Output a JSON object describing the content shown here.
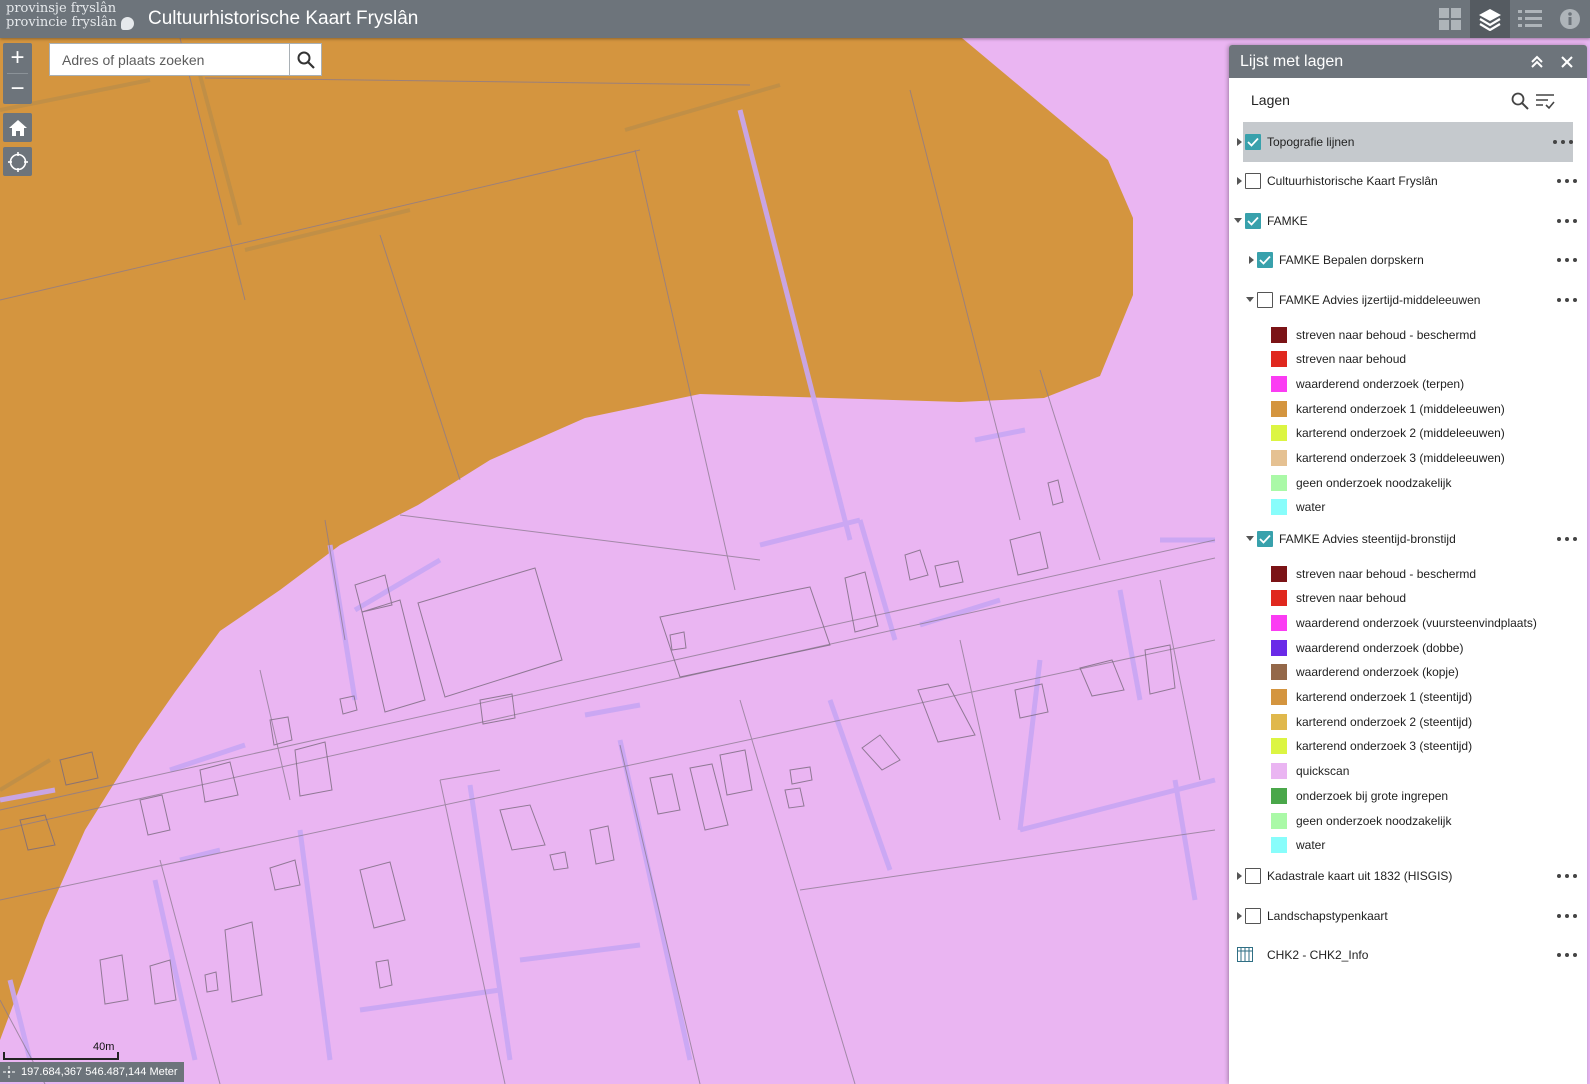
{
  "header": {
    "logo_line1": "provinsje fryslân",
    "logo_line2": "provincie fryslân",
    "title": "Cultuurhistorische Kaart Fryslân",
    "tools": [
      {
        "icon": "grid-icon",
        "active": false
      },
      {
        "icon": "layers-icon",
        "active": true
      },
      {
        "icon": "legend-list-icon",
        "active": false
      },
      {
        "icon": "info-icon",
        "active": false
      }
    ]
  },
  "map": {
    "zoom_in": "+",
    "zoom_out": "−",
    "search_placeholder": "Adres of plaats zoeken",
    "scale_label": "40m",
    "coordinates": "197.684,367 546.487,144 Meter",
    "colors": {
      "background": "#eab5f2",
      "zone": "#d4953f",
      "water_lines": "#c8a6f4"
    }
  },
  "panel": {
    "title": "Lijst met lagen",
    "subheader": "Lagen",
    "layers": [
      {
        "label": "Topografie lijnen",
        "checked": true,
        "expanded": false,
        "selected": true,
        "indent": 0
      },
      {
        "label": "Cultuurhistorische Kaart Fryslân",
        "checked": false,
        "expanded": false,
        "selected": false,
        "indent": 0
      },
      {
        "label": "FAMKE",
        "checked": true,
        "expanded": true,
        "selected": false,
        "indent": 0
      },
      {
        "label": "FAMKE Bepalen dorpskern",
        "checked": true,
        "expanded": false,
        "selected": false,
        "indent": 1
      },
      {
        "label": "FAMKE Advies ijzertijd-middeleeuwen",
        "checked": false,
        "expanded": true,
        "selected": false,
        "indent": 1
      },
      {
        "label": "FAMKE Advies steentijd-bronstijd",
        "checked": true,
        "expanded": true,
        "selected": false,
        "indent": 1
      },
      {
        "label": "Kadastrale kaart uit 1832 (HISGIS)",
        "checked": false,
        "expanded": false,
        "selected": false,
        "indent": 0
      },
      {
        "label": "Landschapstypenkaart",
        "checked": false,
        "expanded": false,
        "selected": false,
        "indent": 0
      },
      {
        "label": "CHK2 - CHK2_Info",
        "checked": null,
        "expanded": false,
        "selected": false,
        "indent": 0
      }
    ],
    "legend_ijzertijd": [
      {
        "label": "streven naar behoud - beschermd",
        "color": "#7b1316"
      },
      {
        "label": "streven naar behoud",
        "color": "#e0281e"
      },
      {
        "label": "waarderend onderzoek (terpen)",
        "color": "#fb3cf3"
      },
      {
        "label": "karterend onderzoek 1 (middeleeuwen)",
        "color": "#d4953f"
      },
      {
        "label": "karterend onderzoek 2 (middeleeuwen)",
        "color": "#dcf542"
      },
      {
        "label": "karterend onderzoek 3 (middeleeuwen)",
        "color": "#e5c192"
      },
      {
        "label": "geen onderzoek noodzakelijk",
        "color": "#aaf9a7"
      },
      {
        "label": "water",
        "color": "#88fdfb"
      }
    ],
    "legend_steentijd": [
      {
        "label": "streven naar behoud - beschermd",
        "color": "#7b1316"
      },
      {
        "label": "streven naar behoud",
        "color": "#e0281e"
      },
      {
        "label": "waarderend onderzoek (vuursteenvindplaats)",
        "color": "#fb3cf3"
      },
      {
        "label": "waarderend onderzoek (dobbe)",
        "color": "#6a2ae8"
      },
      {
        "label": "waarderend onderzoek (kopje)",
        "color": "#946849"
      },
      {
        "label": "karterend onderzoek 1 (steentijd)",
        "color": "#d4953f"
      },
      {
        "label": "karterend onderzoek 2 (steentijd)",
        "color": "#e0b84c"
      },
      {
        "label": "karterend onderzoek 3 (steentijd)",
        "color": "#dcf542"
      },
      {
        "label": "quickscan",
        "color": "#eab5f2"
      },
      {
        "label": "onderzoek bij grote ingrepen",
        "color": "#4aa74a"
      },
      {
        "label": "geen onderzoek noodzakelijk",
        "color": "#aaf9a7"
      },
      {
        "label": "water",
        "color": "#88fdfb"
      }
    ]
  }
}
